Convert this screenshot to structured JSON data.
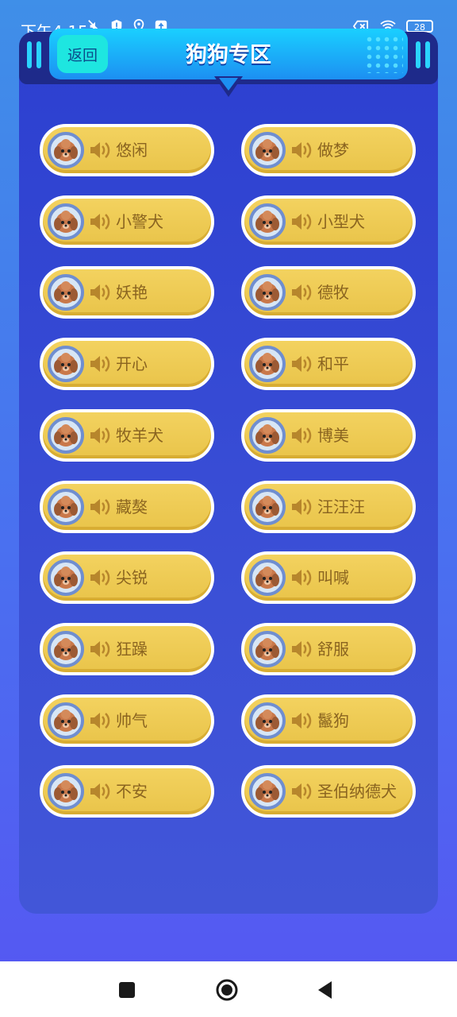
{
  "status_bar": {
    "time": "下午4:15",
    "battery": "28",
    "icons_left": [
      "mute-icon",
      "shield-icon",
      "location-icon",
      "upload-icon"
    ],
    "icons_right": [
      "sim-off-icon",
      "wifi-icon",
      "battery-icon"
    ]
  },
  "header": {
    "back_label": "返回",
    "title": "狗狗专区"
  },
  "colors": {
    "accent_cyan": "#1ee6e0",
    "panel_blue": "#2c3fd0",
    "item_gold": "#f0cd55",
    "label_brown": "#8a6420"
  },
  "sounds": [
    {
      "label": "悠闲"
    },
    {
      "label": "做梦"
    },
    {
      "label": "小警犬"
    },
    {
      "label": "小型犬"
    },
    {
      "label": "妖艳"
    },
    {
      "label": "德牧"
    },
    {
      "label": "开心"
    },
    {
      "label": "和平"
    },
    {
      "label": "牧羊犬"
    },
    {
      "label": "博美"
    },
    {
      "label": "藏獒"
    },
    {
      "label": "汪汪汪"
    },
    {
      "label": "尖锐"
    },
    {
      "label": "叫喊"
    },
    {
      "label": "狂躁"
    },
    {
      "label": "舒服"
    },
    {
      "label": "帅气"
    },
    {
      "label": "鬣狗"
    },
    {
      "label": "不安"
    },
    {
      "label": "圣伯纳德犬"
    }
  ],
  "nav": [
    "recent-apps-button",
    "home-button",
    "back-nav-button"
  ]
}
